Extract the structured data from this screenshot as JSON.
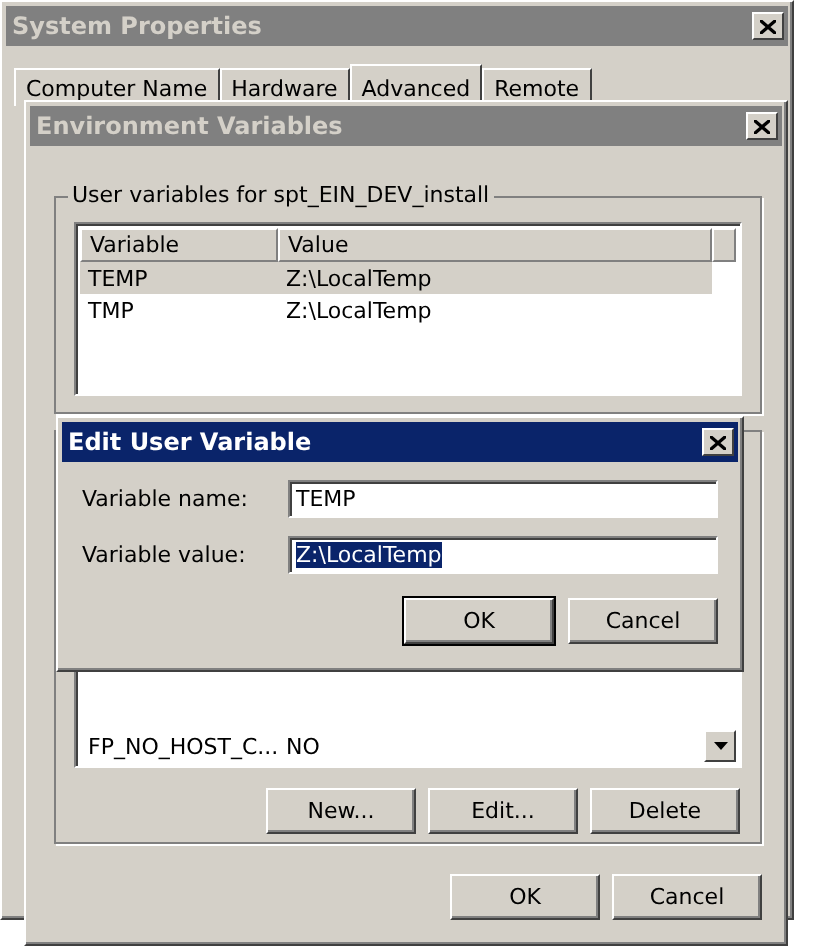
{
  "system_properties": {
    "title": "System Properties",
    "active": false,
    "tabs": [
      {
        "label": "Computer Name",
        "selected": false
      },
      {
        "label": "Hardware",
        "selected": false
      },
      {
        "label": "Advanced",
        "selected": true
      },
      {
        "label": "Remote",
        "selected": false
      }
    ]
  },
  "environment_variables": {
    "title": "Environment Variables",
    "active": false,
    "user_group": {
      "label": "User variables for spt_EIN_DEV_install",
      "columns": [
        "Variable",
        "Value"
      ],
      "rows": [
        {
          "variable": "TEMP",
          "value": "Z:\\LocalTemp",
          "selected": true
        },
        {
          "variable": "TMP",
          "value": "Z:\\LocalTemp",
          "selected": false
        }
      ]
    },
    "system_rows": [
      {
        "variable": "FP_NO_HOST_C...",
        "value": "NO",
        "selected": false
      }
    ],
    "system_buttons": [
      "New...",
      "Edit...",
      "Delete"
    ],
    "buttons": [
      "OK",
      "Cancel"
    ]
  },
  "edit_dialog": {
    "title": "Edit User Variable",
    "active": true,
    "fields": [
      {
        "label": "Variable name:",
        "value": "TEMP",
        "text_selected": false
      },
      {
        "label": "Variable value:",
        "value": "Z:\\LocalTemp",
        "text_selected": true
      }
    ],
    "buttons": [
      "OK",
      "Cancel"
    ]
  }
}
